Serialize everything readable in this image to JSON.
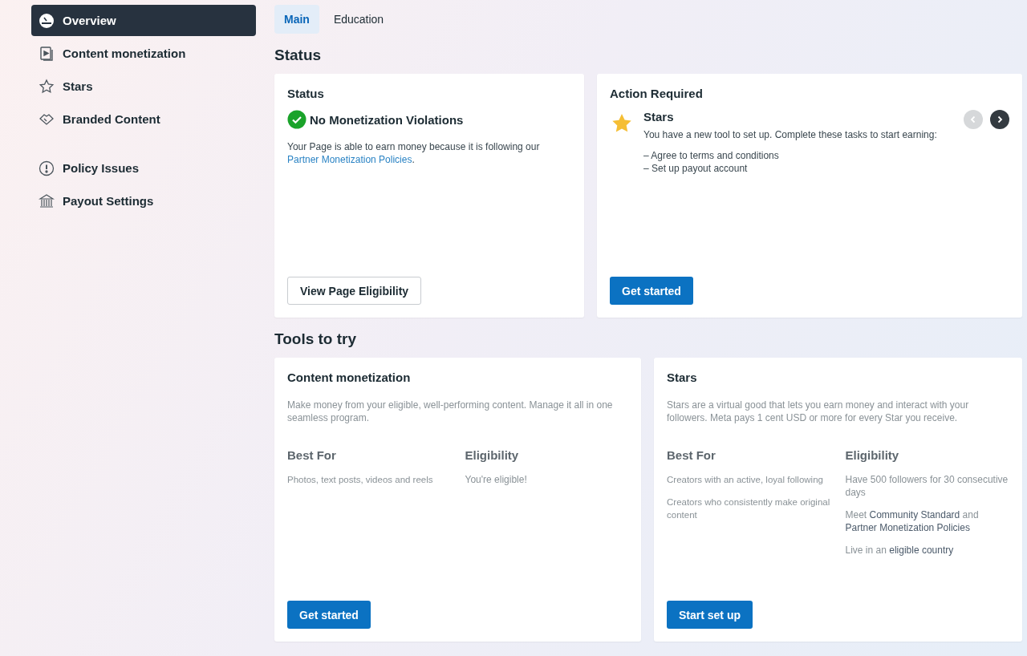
{
  "sidebar": {
    "groups": [
      {
        "items": [
          {
            "label": "Overview",
            "selected": true
          },
          {
            "label": "Content monetization",
            "selected": false
          },
          {
            "label": "Stars",
            "selected": false
          },
          {
            "label": "Branded Content",
            "selected": false
          }
        ]
      },
      {
        "items": [
          {
            "label": "Policy Issues",
            "selected": false
          },
          {
            "label": "Payout Settings",
            "selected": false
          }
        ]
      }
    ]
  },
  "tabs": [
    {
      "label": "Main",
      "selected": true
    },
    {
      "label": "Education",
      "selected": false
    }
  ],
  "status_section": {
    "heading": "Status",
    "status_card": {
      "title": "Status",
      "headline": "No Monetization Violations",
      "body": [
        {
          "text": "Your Page is able to earn money because it is following our ",
          "kind": "plain"
        },
        {
          "text": "Partner Monetization Policies",
          "kind": "link"
        },
        {
          "text": ".",
          "kind": "plain"
        }
      ],
      "button": "View Page Eligibility"
    },
    "action_card": {
      "title": "Action Required",
      "item_title": "Stars",
      "description": "You have a new tool to set up. Complete these tasks to start earning:",
      "tasks": [
        "– Agree to terms and conditions",
        "– Set up payout account"
      ],
      "prev_disabled": true,
      "next_disabled": false,
      "button": "Get started"
    }
  },
  "tools_section": {
    "heading": "Tools to try",
    "cards": [
      {
        "title": "Content monetization",
        "description": "Make money from your eligible, well-performing content. Manage it all in one seamless program.",
        "best_for_heading": "Best For",
        "best_for": [
          "Photos, text posts, videos and reels"
        ],
        "eligibility_heading": "Eligibility",
        "eligibility": [
          [
            {
              "text": "You're eligible!",
              "kind": "plain"
            }
          ]
        ],
        "button": "Get started"
      },
      {
        "title": "Stars",
        "description": "Stars are a virtual good that lets you earn money and interact with your followers. Meta pays 1 cent USD or more for every Star you receive.",
        "best_for_heading": "Best For",
        "best_for": [
          "Creators with an active, loyal following",
          "Creators who consistently make original content"
        ],
        "eligibility_heading": "Eligibility",
        "eligibility": [
          [
            {
              "text": "Have 500 followers for 30 consecutive days",
              "kind": "plain"
            }
          ],
          [
            {
              "text": "Meet ",
              "kind": "plain"
            },
            {
              "text": "Community Standard",
              "kind": "link"
            },
            {
              "text": " and ",
              "kind": "plain"
            },
            {
              "text": "Partner Monetization Policies",
              "kind": "link"
            }
          ],
          [
            {
              "text": "Live in an ",
              "kind": "plain"
            },
            {
              "text": "eligible country",
              "kind": "link"
            }
          ]
        ],
        "button": "Start set up"
      }
    ]
  }
}
